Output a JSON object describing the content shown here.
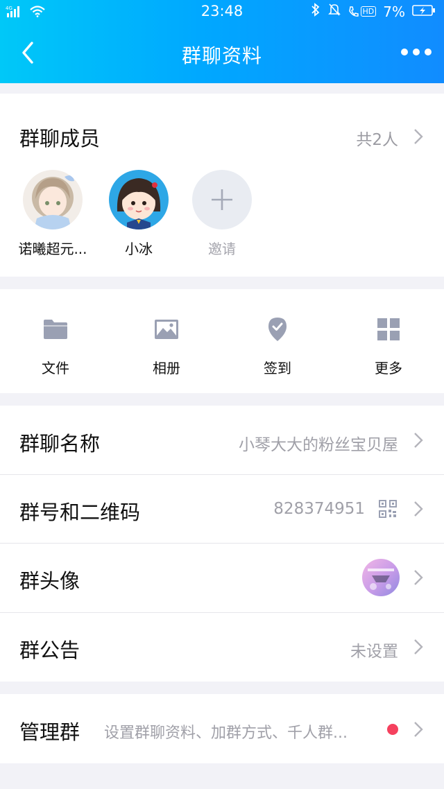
{
  "status_bar": {
    "signal": "4G",
    "time": "23:48",
    "battery": "7%",
    "hd": "HD"
  },
  "nav": {
    "title": "群聊资料"
  },
  "members": {
    "title": "群聊成员",
    "count": "共2人",
    "list": [
      {
        "name": "诺曦超元..."
      },
      {
        "name": "小冰"
      }
    ],
    "invite_label": "邀请"
  },
  "tools": [
    {
      "label": "文件",
      "icon": "folder-icon"
    },
    {
      "label": "相册",
      "icon": "image-icon"
    },
    {
      "label": "签到",
      "icon": "checkin-pin-icon"
    },
    {
      "label": "更多",
      "icon": "grid-icon"
    }
  ],
  "settings": {
    "group_name": {
      "label": "群聊名称",
      "value": "小琴大大的粉丝宝贝屋"
    },
    "group_id": {
      "label": "群号和二维码",
      "value": "828374951"
    },
    "group_avatar": {
      "label": "群头像"
    },
    "announcement": {
      "label": "群公告",
      "value": "未设置"
    }
  },
  "manage": {
    "label": "管理群",
    "desc": "设置群聊资料、加群方式、千人群..."
  },
  "colors": {
    "header_start": "#00c8f8",
    "header_end": "#118cff",
    "icon_gray": "#9aa0b3",
    "badge_red": "#f5415e"
  }
}
